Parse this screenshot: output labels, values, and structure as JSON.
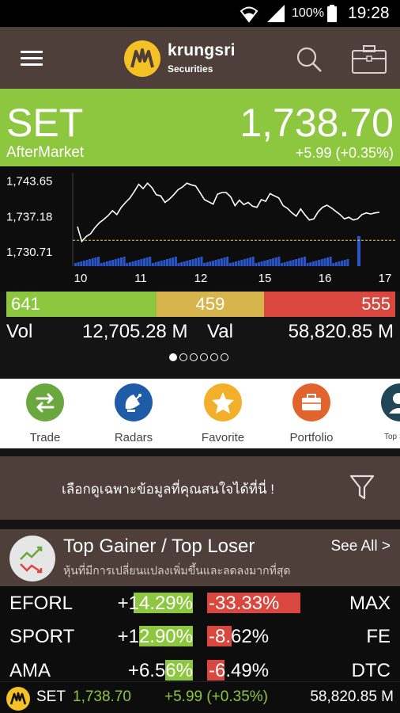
{
  "status_bar": {
    "battery": "100%",
    "time": "19:28"
  },
  "header": {
    "brand": "krungsri",
    "brand_sub": "Securities",
    "icons": [
      "menu-icon",
      "search-icon",
      "briefcase-icon"
    ]
  },
  "index": {
    "name": "SET",
    "value": "1,738.70",
    "session": "AfterMarket",
    "change": "+5.99 (+0.35%)"
  },
  "chart_data": {
    "type": "line",
    "y_ticks": [
      "1,743.65",
      "1,737.18",
      "1,730.71"
    ],
    "x_ticks": [
      "10",
      "11",
      "12",
      "15",
      "16",
      "17"
    ],
    "ylim": [
      1728,
      1745
    ],
    "prior_close": 1732.71,
    "series": [
      {
        "values": [
          1735.2,
          1732.5,
          1733.4,
          1733.9,
          1735.0,
          1735.9,
          1736.5,
          1737.2,
          1738.1,
          1737.4,
          1738.7,
          1739.6,
          1740.4,
          1741.6,
          1742.9,
          1742.1,
          1743.1,
          1742.3,
          1741.0,
          1740.8,
          1739.6,
          1740.2,
          1741.0,
          1741.9,
          1742.4,
          1743.1,
          1742.8,
          1742.6,
          1741.4,
          1740.1,
          1739.7,
          1739.3,
          1741.1,
          1741.4,
          1741.4,
          1740.6,
          1739.0,
          1740.0,
          1739.2,
          1739.6,
          1738.9,
          1738.7,
          1740.1,
          1739.8,
          1741.2,
          1740.8,
          1740.4,
          1739.0,
          1738.5,
          1737.7,
          1737.1,
          1738.4,
          1737.3,
          1736.4,
          1736.6,
          1737.9,
          1738.7,
          1739.1,
          1738.6,
          1738.0,
          1737.4,
          1736.6,
          1736.9,
          1736.4,
          1736.6,
          1737.4,
          1737.7,
          1737.5,
          1737.7,
          1737.8
        ]
      }
    ],
    "volume_bars": 96
  },
  "breadth": {
    "advance": "641",
    "unchanged": "459",
    "decline": "555"
  },
  "summary": {
    "vol_label": "Vol",
    "vol_value": "12,705.28 M",
    "val_label": "Val",
    "val_value": "58,820.85 M"
  },
  "pager": {
    "pages": 6,
    "active": 0
  },
  "shortcuts": [
    {
      "label": "Trade",
      "color": "#6aa83f",
      "icon": "exchange-icon"
    },
    {
      "label": "Radars",
      "color": "#1f5ca8",
      "icon": "radar-dish-icon"
    },
    {
      "label": "Favorite",
      "color": "#f2b02a",
      "icon": "star-icon"
    },
    {
      "label": "Portfolio",
      "color": "#e0642b",
      "icon": "briefcase-icon"
    },
    {
      "label": "Top Shar",
      "color": "#214657",
      "icon": "person-icon"
    }
  ],
  "filter_banner": {
    "text": "เลือกดูเฉพาะข้อมูลที่คุณสนใจได้ที่นี่ !",
    "icon": "filter-icon"
  },
  "top_gainer": {
    "title": "Top Gainer / Top Loser",
    "see_all": "See All >",
    "subtitle": "หุ้นที่มีการเปลี่ยนแปลงเพิ่มขึ้นและลดลงมากที่สุด",
    "rows": [
      {
        "gainer": "EFORL",
        "gain": "+14.29%",
        "gain_fill": 0.43,
        "loss": "-33.33%",
        "loss_fill": 1.0,
        "loser": "MAX"
      },
      {
        "gainer": "SPORT",
        "gain": "+12.90%",
        "gain_fill": 0.39,
        "loss": "-8.62%",
        "loss_fill": 0.26,
        "loser": "FE"
      },
      {
        "gainer": "AMA",
        "gain": "+6.56%",
        "gain_fill": 0.2,
        "loss": "-6.49%",
        "loss_fill": 0.19,
        "loser": "DTC"
      }
    ]
  },
  "ticker": {
    "name": "SET",
    "value": "1,738.70",
    "change": "+5.99 (+0.35%)",
    "val": "58,820.85 M"
  }
}
